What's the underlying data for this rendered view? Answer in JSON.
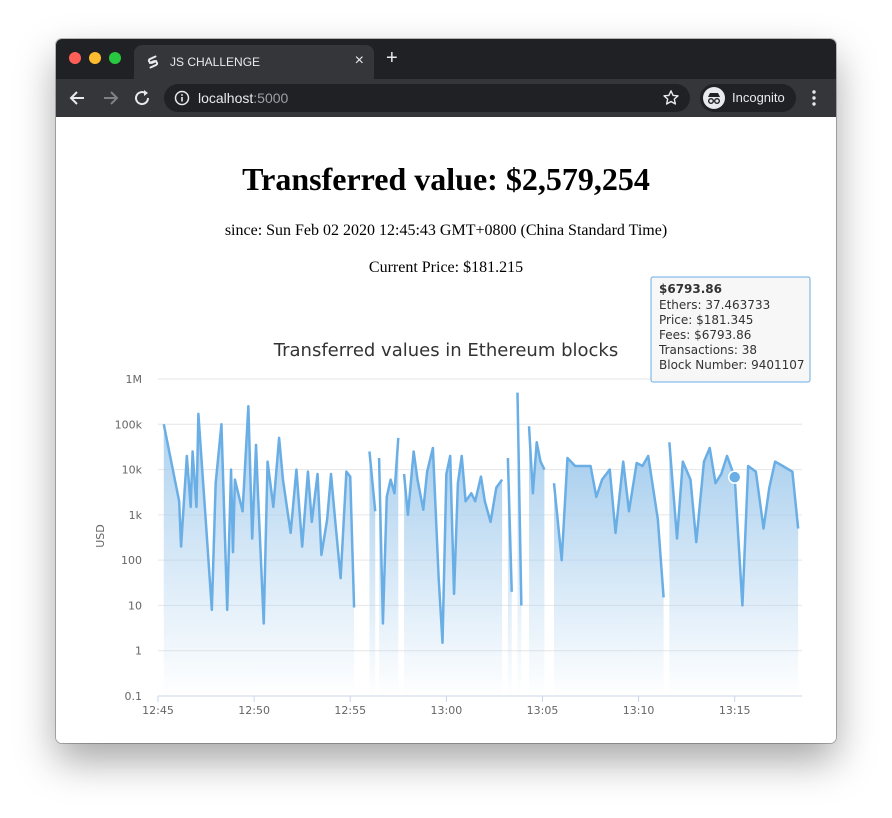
{
  "browser": {
    "tab_title": "JS CHALLENGE",
    "tab_close": "×",
    "new_tab": "+",
    "url_host": "localhost",
    "url_port": ":5000",
    "incognito_label": "Incognito"
  },
  "page": {
    "title": "Transferred value: $2,579,254",
    "since": "since: Sun Feb 02 2020 12:45:43 GMT+0800 (China Standard Time)",
    "current_price": "Current Price: $181.215"
  },
  "tooltip": {
    "title": "$6793.86",
    "lines": [
      "Ethers: 37.463733",
      "Price: $181.345",
      "Fees: $6793.86",
      "Transactions: 38",
      "Block Number: 9401107"
    ]
  },
  "colors": {
    "series": "#6aaee6",
    "area_top": "#a9cfee",
    "grid": "#e6e6e6"
  },
  "chart_data": {
    "type": "area",
    "title": "Transferred values in Ethereum blocks",
    "ylabel": "USD",
    "yscale": "log",
    "ylim": [
      0.1,
      1000000
    ],
    "ytick_labels": [
      "0.1",
      "1",
      "10",
      "100",
      "1k",
      "10k",
      "100k",
      "1M"
    ],
    "xlim_minutes": [
      0,
      33.5
    ],
    "xtick_labels": [
      "12:45",
      "12:50",
      "12:55",
      "13:00",
      "13:05",
      "13:10",
      "13:15"
    ],
    "segments": [
      {
        "x": [
          0.3,
          1.1,
          1.2,
          1.5,
          1.7,
          1.8,
          2.0,
          2.1,
          2.5,
          2.8,
          3.0,
          3.3,
          3.6,
          3.8,
          3.9,
          4.0,
          4.4,
          4.7,
          4.9,
          5.1,
          5.2,
          5.5,
          5.7,
          6.0,
          6.3,
          6.5,
          6.9,
          7.2,
          7.5,
          7.8,
          8.0,
          8.3,
          8.5,
          8.8,
          9.0,
          9.2,
          9.5,
          9.8,
          10.0,
          10.2
        ],
        "y": [
          100000,
          2000,
          200,
          20000,
          1500,
          25000,
          1500,
          170000,
          600,
          8,
          5000,
          100000,
          8,
          10000,
          150,
          6000,
          1200,
          250000,
          300,
          35000,
          3000,
          4,
          15000,
          1500,
          50000,
          6000,
          400,
          10000,
          200,
          9000,
          700,
          8000,
          130,
          800,
          8000,
          900,
          40,
          9000,
          7000,
          9
        ]
      },
      {
        "x": [
          11.0,
          11.3
        ],
        "y": [
          25000,
          1200
        ]
      },
      {
        "x": [
          11.5,
          11.7,
          11.9,
          12.1,
          12.3,
          12.5
        ],
        "y": [
          18000,
          4,
          2500,
          6000,
          3000,
          50000
        ]
      },
      {
        "x": [
          12.8,
          13.0,
          13.3,
          13.5,
          13.8,
          14.0,
          14.3,
          14.6,
          14.8,
          15.0,
          15.2,
          15.4,
          15.6,
          15.8,
          16.0,
          16.3,
          16.5,
          16.8,
          17.0,
          17.3,
          17.6,
          17.9
        ],
        "y": [
          8000,
          1000,
          25000,
          6000,
          1300,
          9000,
          30000,
          40,
          1.5,
          8000,
          20000,
          18,
          5000,
          20000,
          2000,
          3000,
          2000,
          7000,
          2000,
          700,
          4000,
          6000
        ]
      },
      {
        "x": [
          18.2,
          18.4
        ],
        "y": [
          18000,
          20
        ]
      },
      {
        "x": [
          18.7,
          18.9
        ],
        "y": [
          500000,
          10
        ]
      },
      {
        "x": [
          19.3,
          19.5,
          19.7,
          19.9,
          20.1
        ],
        "y": [
          90000,
          3000,
          40000,
          15000,
          10000
        ]
      },
      {
        "x": [
          20.6,
          21.0,
          21.3,
          21.7,
          22.0,
          22.5,
          22.8,
          23.1,
          23.5,
          23.8,
          24.2,
          24.5,
          24.9,
          25.2,
          25.5,
          26.0,
          26.3
        ],
        "y": [
          5000,
          100,
          18000,
          12000,
          12000,
          12000,
          2500,
          6000,
          10000,
          400,
          15000,
          1200,
          14000,
          12000,
          20000,
          800,
          15
        ]
      },
      {
        "x": [
          26.6,
          27.0,
          27.3,
          27.7,
          28.0,
          28.4,
          28.7,
          29.0,
          29.3,
          29.6,
          30.0,
          30.4,
          30.7,
          31.1,
          31.5,
          31.8,
          32.1,
          32.5,
          33.0,
          33.3
        ],
        "y": [
          40000,
          300,
          15000,
          6000,
          250,
          15000,
          30000,
          5000,
          8000,
          20000,
          6793.86,
          10,
          12000,
          9000,
          500,
          4000,
          15000,
          12000,
          9000,
          500
        ]
      }
    ],
    "highlight": {
      "x": 30.0,
      "y": 6793.86
    }
  }
}
